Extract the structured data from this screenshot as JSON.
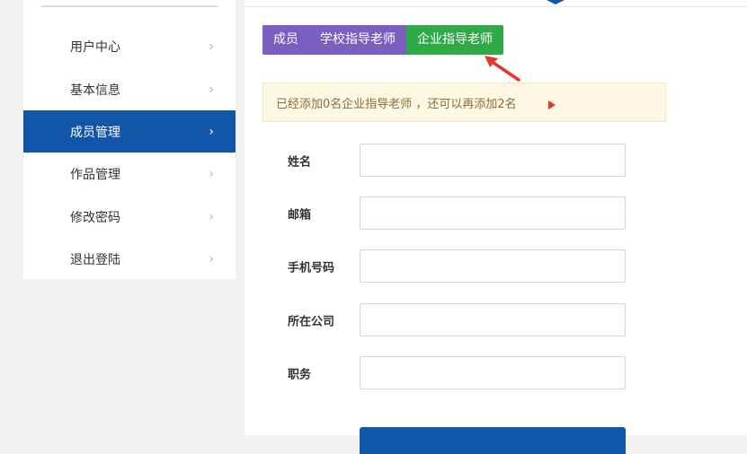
{
  "sidebar": {
    "items": [
      {
        "label": "用户中心",
        "icon": "chevron-right-icon"
      },
      {
        "label": "基本信息",
        "icon": "chevron-right-icon"
      },
      {
        "label": "成员管理",
        "icon": "chevron-right-icon",
        "active": true
      },
      {
        "label": "作品管理",
        "icon": "chevron-right-icon"
      },
      {
        "label": "修改密码",
        "icon": "chevron-right-icon"
      },
      {
        "label": "退出登陆",
        "icon": "chevron-right-icon"
      }
    ],
    "chevron": "›"
  },
  "tabs": [
    {
      "label": "成员"
    },
    {
      "label": "学校指导老师"
    },
    {
      "label": "企业指导老师",
      "active": true
    }
  ],
  "notice": {
    "text": "已经添加0名企业指导老师 ，还可以再添加2名"
  },
  "form": {
    "fields": [
      {
        "label": "姓名",
        "value": ""
      },
      {
        "label": "邮箱",
        "value": ""
      },
      {
        "label": "手机号码",
        "value": ""
      },
      {
        "label": "所在公司",
        "value": ""
      },
      {
        "label": "职务",
        "value": ""
      }
    ]
  },
  "colors": {
    "sidebar_active": "#1156a8",
    "tab_purple": "#7a5ec0",
    "tab_green": "#2eaa46",
    "notice_bg": "#fcf8e3",
    "annotation_red": "#e8362b"
  }
}
